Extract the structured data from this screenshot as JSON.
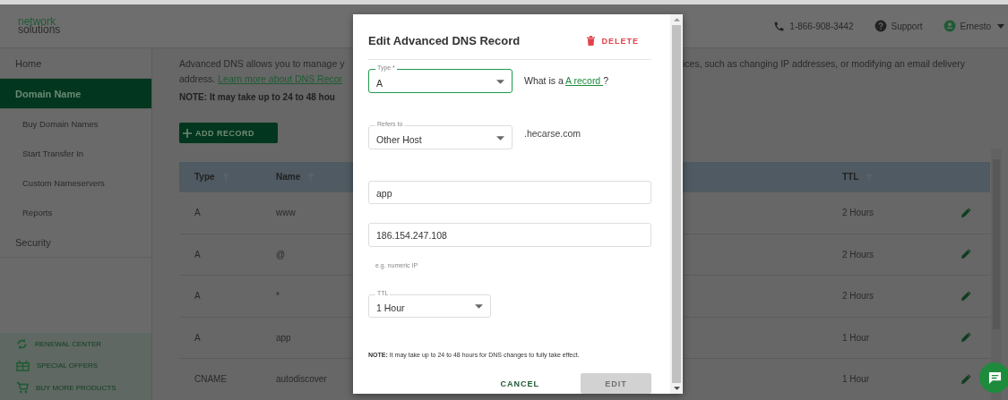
{
  "header": {
    "logo": [
      "network",
      "solutions"
    ],
    "phone": "1-866-908-3442",
    "support": "Support",
    "user": "Ernesto"
  },
  "sidebar": {
    "items": [
      {
        "label": "Home",
        "kind": "section",
        "selected": false
      },
      {
        "label": "Domain Name",
        "kind": "section",
        "selected": true
      },
      {
        "label": "Buy Domain Names",
        "kind": "sub",
        "selected": false
      },
      {
        "label": "Start Transfer In",
        "kind": "sub",
        "selected": false
      },
      {
        "label": "Custom Nameservers",
        "kind": "sub",
        "selected": false
      },
      {
        "label": "Reports",
        "kind": "sub",
        "selected": false
      },
      {
        "label": "Security",
        "kind": "section",
        "selected": false
      }
    ],
    "links": [
      {
        "label": "RENEWAL CENTER",
        "kind": "renew"
      },
      {
        "label": "SPECIAL OFFERS",
        "kind": "gift"
      },
      {
        "label": "BUY MORE PRODUCTS",
        "kind": "cart"
      }
    ]
  },
  "main": {
    "intro_left": "Advanced DNS allows you to manage y",
    "intro_prefix": "address.",
    "intro_link": "Learn more about DNS Recor",
    "intro_right": "ices, such as changing IP addresses, or modifying an email delivery",
    "note": "NOTE: It may take up to 24 to 48 hou",
    "add_button": "ADD RECORD",
    "table": {
      "columns": [
        "Type",
        "Name",
        "TTL"
      ],
      "rows": [
        {
          "type": "A",
          "name": "www",
          "ttl": "2 Hours"
        },
        {
          "type": "A",
          "name": "@",
          "ttl": "2 Hours"
        },
        {
          "type": "A",
          "name": "*",
          "ttl": "2 Hours"
        },
        {
          "type": "A",
          "name": "app",
          "ttl": "1 Hour"
        },
        {
          "type": "CNAME",
          "name": "autodiscover",
          "ttl": "1 Hour"
        }
      ]
    }
  },
  "modal": {
    "title": "Edit Advanced DNS Record",
    "delete": "DELETE",
    "type_label": "Type *",
    "type_value": "A",
    "type_help": "What is a",
    "type_help_link": "A record ",
    "type_help_end": "?",
    "refers_label": "Refers to",
    "refers_value": "Other Host",
    "domain": ".hecarse.com",
    "host_value": "app",
    "ip_value": "186.154.247.108",
    "ip_hint": "e.g. numeric IP",
    "ttl_label": "TTL",
    "ttl_value": "1 Hour",
    "note_bold": "NOTE:",
    "note": "It may take up to 24 to 48 hours for DNS changes to fully take effect.",
    "cancel": "CANCEL",
    "edit": "EDIT",
    "edit_disabled": true
  }
}
